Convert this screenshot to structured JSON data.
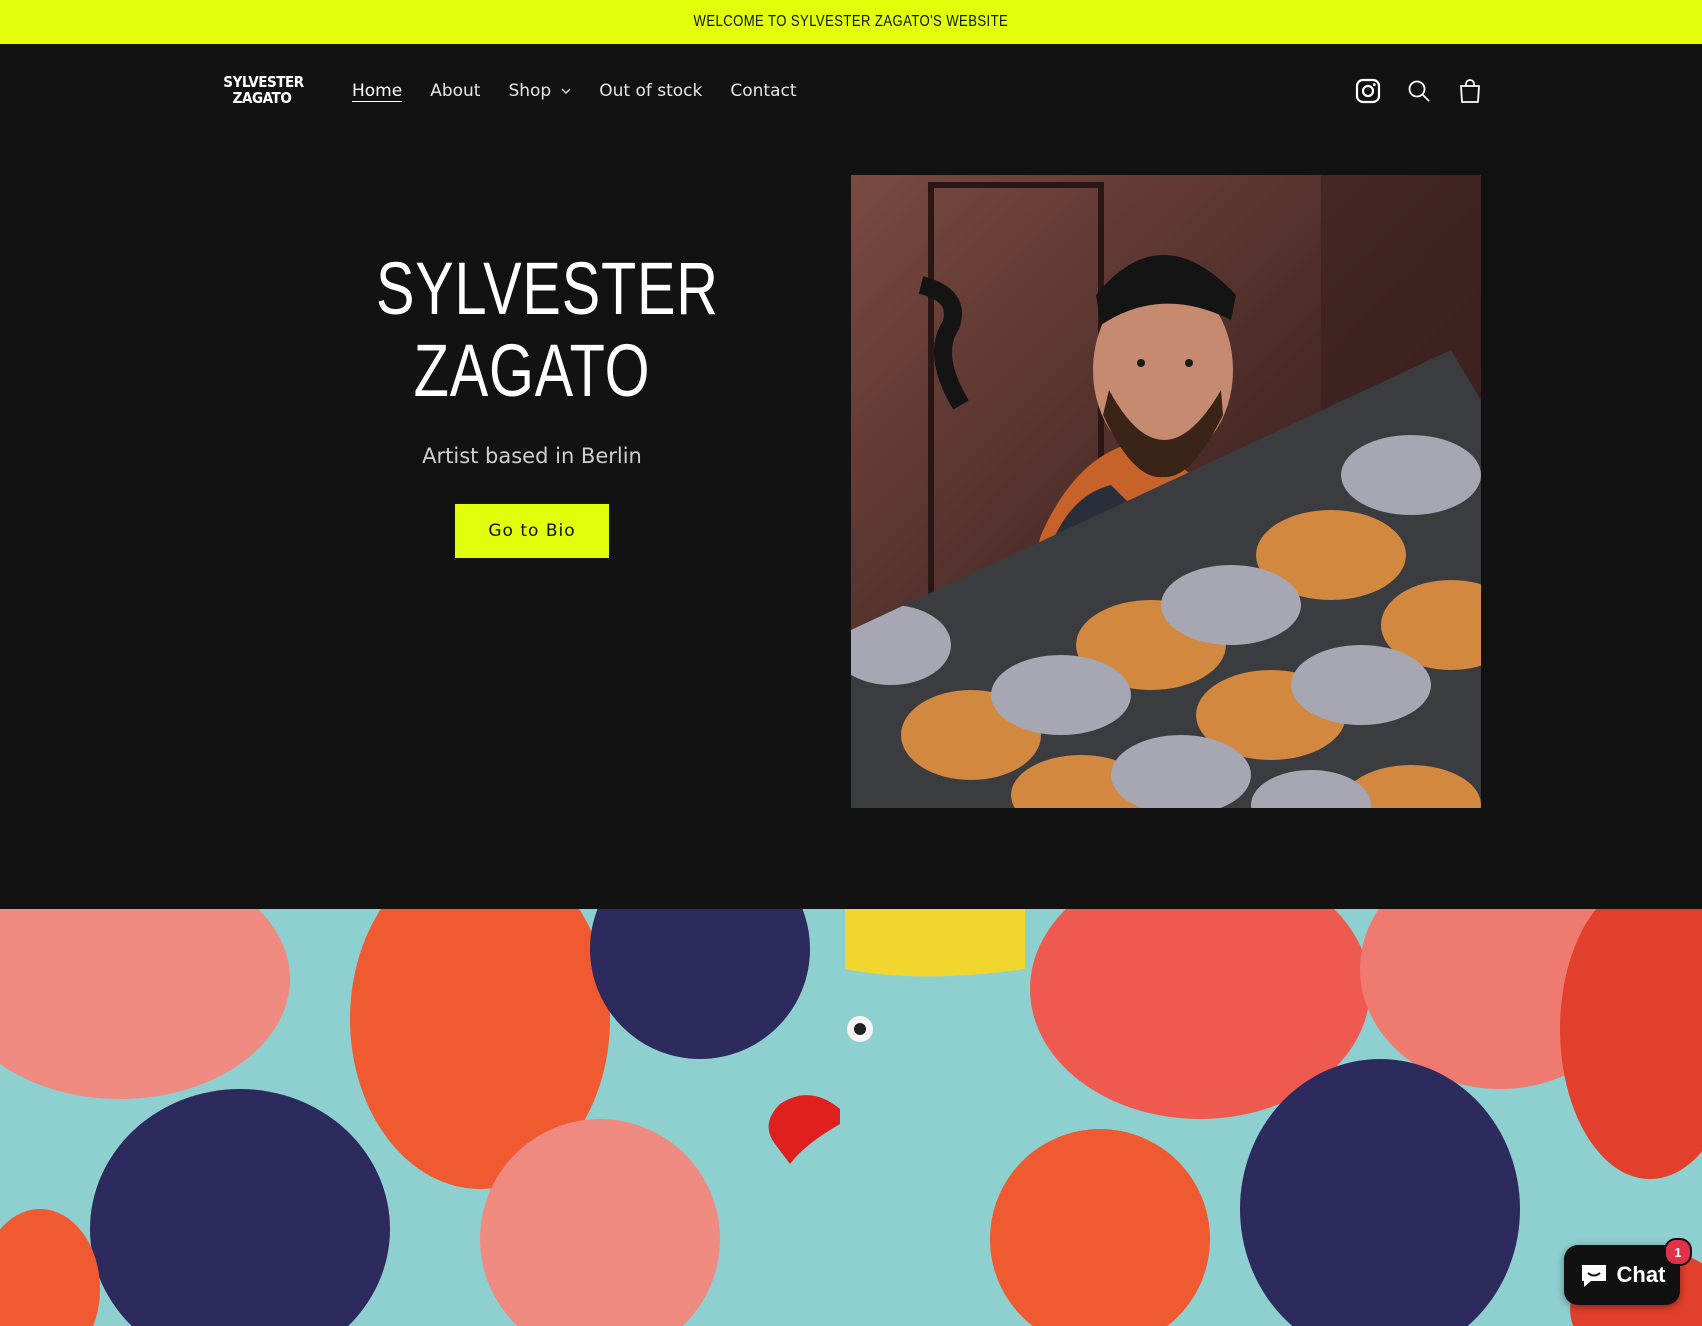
{
  "announcement": {
    "text": "WELCOME TO SYLVESTER ZAGATO'S WEBSITE"
  },
  "header": {
    "logo_line1": "SYLVESTER",
    "logo_line2": "ZAGATO",
    "nav": [
      {
        "label": "Home",
        "active": true
      },
      {
        "label": "About"
      },
      {
        "label": "Shop",
        "icon": "chevron-down-icon"
      },
      {
        "label": "Out of stock"
      },
      {
        "label": "Contact"
      }
    ],
    "icons": [
      "instagram-icon",
      "search-icon",
      "cart-icon"
    ]
  },
  "hero": {
    "title_line1": "SYLVESTER",
    "title_line2": "ZAGATO",
    "subtitle": "Artist based in Berlin",
    "button_label": "Go to Bio"
  },
  "chat": {
    "label": "Chat",
    "badge": "1"
  },
  "colors": {
    "accent": "#e2ff0b",
    "background": "#121212",
    "badge": "#e0304a"
  }
}
